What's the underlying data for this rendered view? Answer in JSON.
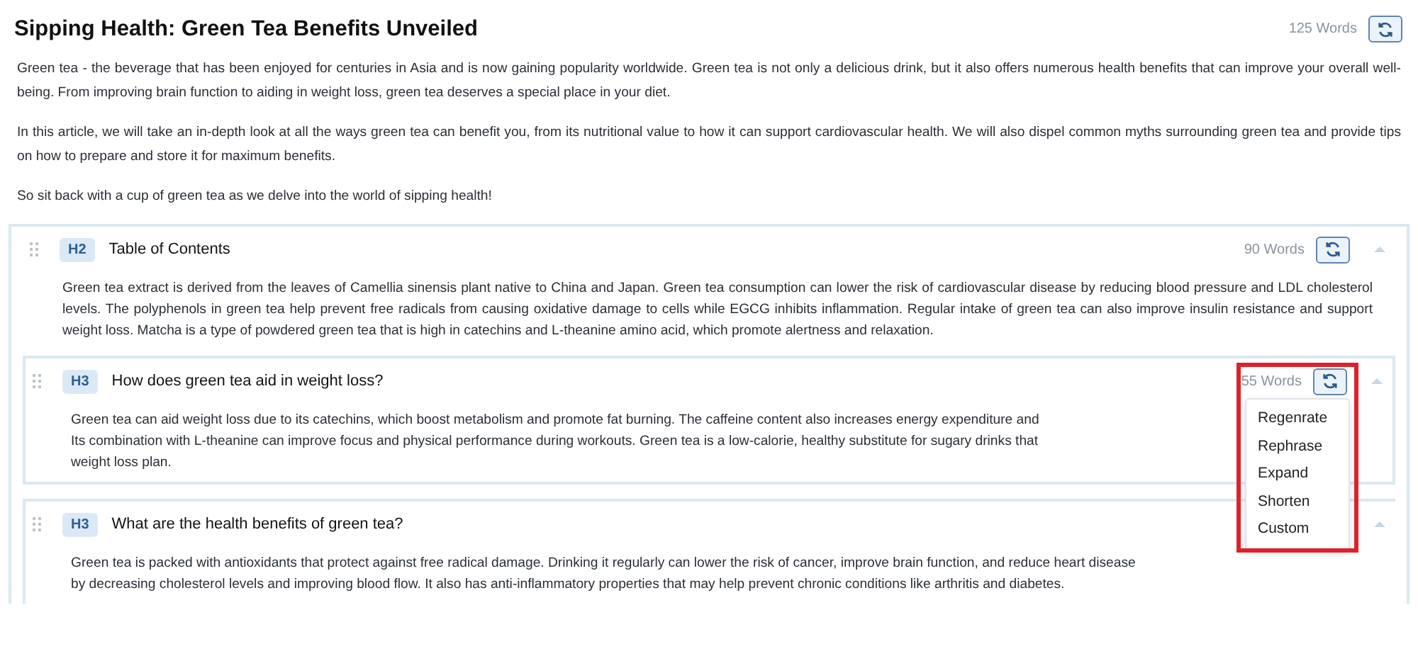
{
  "article": {
    "title": "Sipping Health: Green Tea Benefits Unveiled",
    "word_count": "125 Words",
    "paragraphs": [
      "Green tea - the beverage that has been enjoyed for centuries in Asia and is now gaining popularity worldwide. Green tea is not only a delicious drink, but it also offers numerous health benefits that can improve your overall well-being. From improving brain function to aiding in weight loss, green tea deserves a special place in your diet.",
      "In this article, we will take an in-depth look at all the ways green tea can benefit you, from its nutritional value to how it can support cardiovascular health. We will also dispel common myths surrounding green tea and provide tips on how to prepare and store it for maximum benefits.",
      "So sit back with a cup of green tea as we delve into the world of sipping health!"
    ]
  },
  "section": {
    "level": "H2",
    "heading": "Table of Contents",
    "word_count": "90 Words",
    "expanded": true,
    "text": "Green tea extract is derived from the leaves of Camellia sinensis plant native to China and Japan. Green tea consumption can lower the risk of cardiovascular disease by reducing blood pressure and LDL cholesterol levels. The polyphenols in green tea help prevent free radicals from causing oxidative damage to cells while EGCG inhibits inflammation. Regular intake of green tea can also improve insulin resistance and support weight loss. Matcha is a type of powdered green tea that is high in catechins and L-theanine amino acid, which promote alertness and relaxation.",
    "children": [
      {
        "level": "H3",
        "heading": "How does green tea aid in weight loss?",
        "word_count": "55 Words",
        "expanded": true,
        "menu_open": true,
        "lines": [
          "Green tea can aid weight loss due to its catechins, which boost metabolism and promote fat burning. The caffeine content also increases energy expenditure and",
          "Its combination with L-theanine can improve focus and physical performance during workouts. Green tea is a low-calorie, healthy substitute for sugary drinks that",
          "weight loss plan."
        ]
      },
      {
        "level": "H3",
        "heading": "What are the health benefits of green tea?",
        "expanded": true,
        "menu_open": false,
        "lines": [
          "Green tea is packed with antioxidants that protect against free radical damage. Drinking it regularly can lower the risk of cancer, improve brain function, and reduce heart disease",
          "by decreasing cholesterol levels and improving blood flow. It also has anti-inflammatory properties that may help prevent chronic conditions like arthritis and diabetes."
        ]
      }
    ]
  },
  "menu": [
    "Regenrate",
    "Rephrase",
    "Expand",
    "Shorten",
    "Custom"
  ]
}
